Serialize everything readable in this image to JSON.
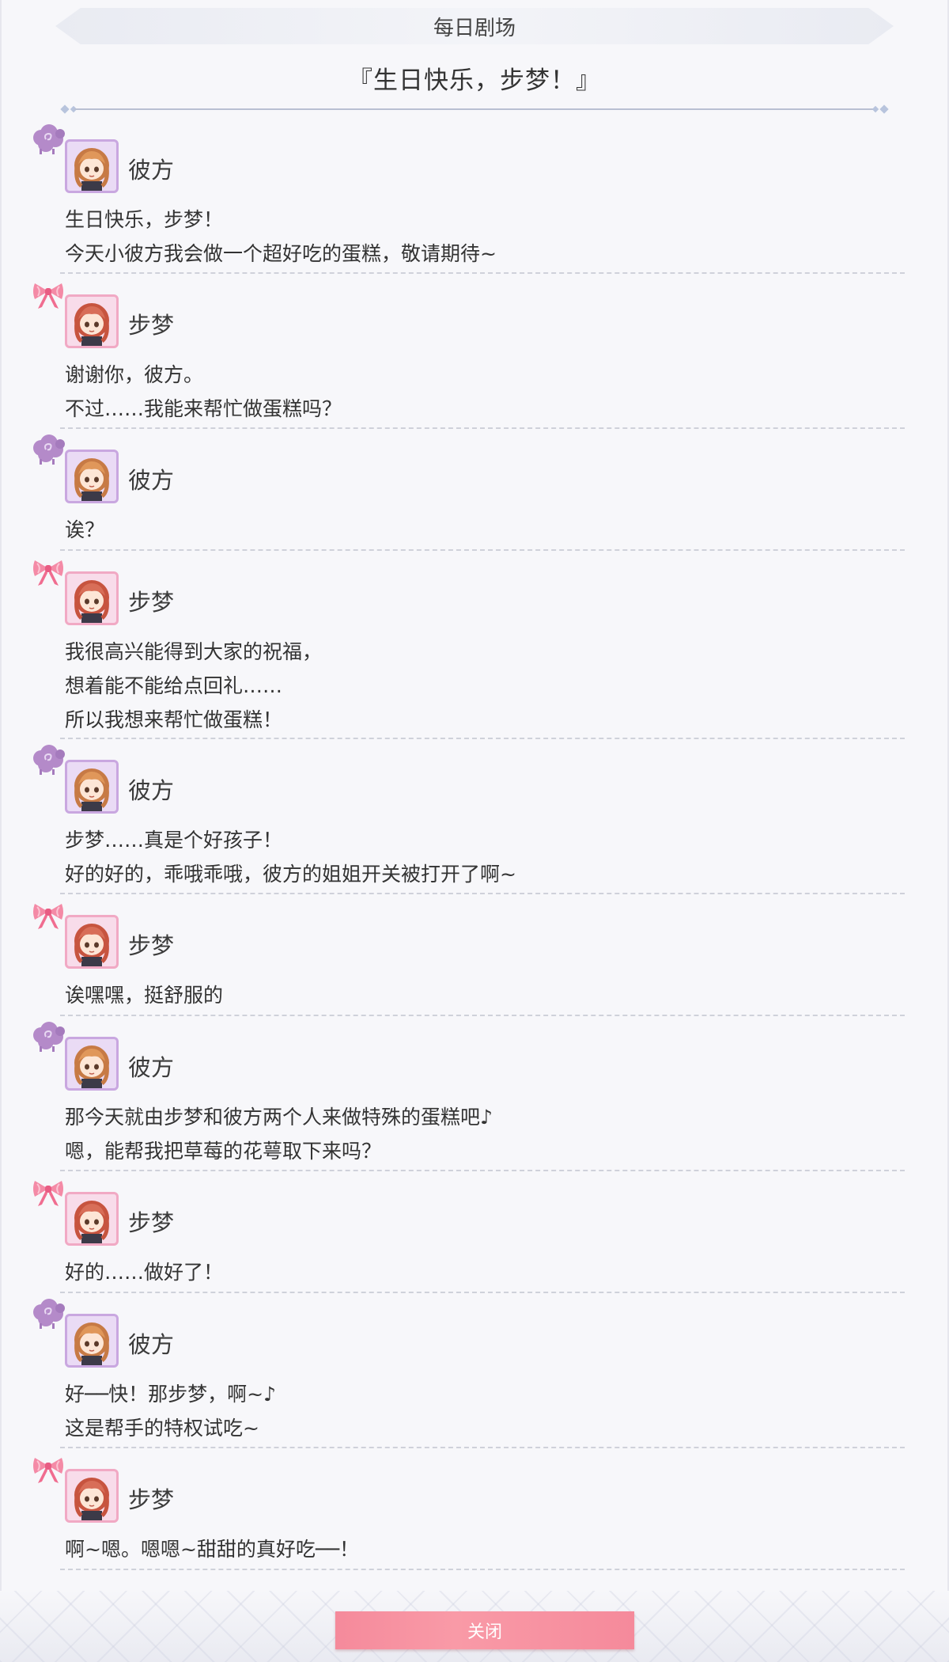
{
  "header": {
    "title": "每日剧场"
  },
  "story_title": "『生日快乐，步梦！』",
  "dialog": [
    {
      "speaker": "彼方",
      "character": "kanata",
      "lines": [
        "生日快乐，步梦！",
        "今天小彼方我会做一个超好吃的蛋糕，敬请期待~"
      ]
    },
    {
      "speaker": "步梦",
      "character": "ayumu",
      "lines": [
        "谢谢你，彼方。",
        "不过……我能来帮忙做蛋糕吗？"
      ]
    },
    {
      "speaker": "彼方",
      "character": "kanata",
      "lines": [
        "诶？"
      ]
    },
    {
      "speaker": "步梦",
      "character": "ayumu",
      "lines": [
        "我很高兴能得到大家的祝福，",
        "想着能不能给点回礼……",
        "所以我想来帮忙做蛋糕！"
      ]
    },
    {
      "speaker": "彼方",
      "character": "kanata",
      "lines": [
        "步梦……真是个好孩子！",
        "好的好的，乖哦乖哦，彼方的姐姐开关被打开了啊~"
      ]
    },
    {
      "speaker": "步梦",
      "character": "ayumu",
      "lines": [
        "诶嘿嘿，挺舒服的"
      ]
    },
    {
      "speaker": "彼方",
      "character": "kanata",
      "lines": [
        "那今天就由步梦和彼方两个人来做特殊的蛋糕吧♪",
        "嗯，能帮我把草莓的花萼取下来吗？"
      ]
    },
    {
      "speaker": "步梦",
      "character": "ayumu",
      "lines": [
        "好的……做好了！"
      ]
    },
    {
      "speaker": "彼方",
      "character": "kanata",
      "lines": [
        "好──快！那步梦，啊~♪",
        "这是帮手的特权试吃~"
      ]
    },
    {
      "speaker": "步梦",
      "character": "ayumu",
      "lines": [
        "啊~嗯。嗯嗯~甜甜的真好吃──！"
      ]
    }
  ],
  "footer": {
    "close_label": "关闭"
  },
  "icons": {
    "kanata_emblem": "sheep-icon",
    "ayumu_emblem": "ribbon-bow-icon"
  },
  "colors": {
    "kanata_accent": "#c9a7e0",
    "ayumu_accent": "#f1a9c4",
    "close_button": "#f58a9b"
  }
}
